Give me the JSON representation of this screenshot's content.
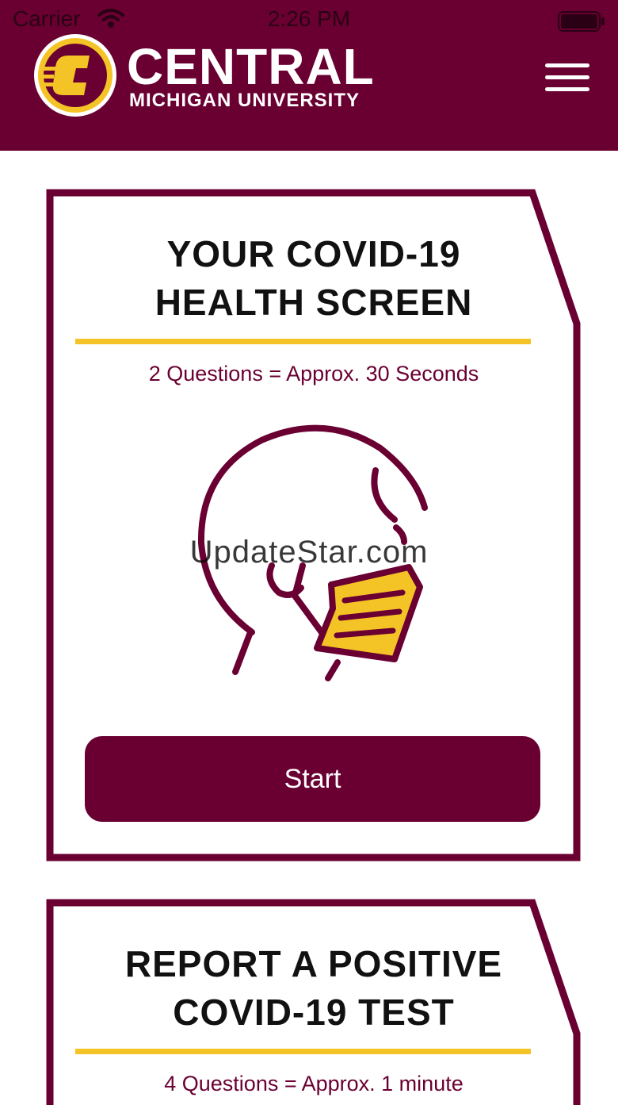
{
  "status_bar": {
    "carrier": "Carrier",
    "time": "2:26 PM",
    "wifi_icon": "wifi-icon",
    "battery_icon": "battery-icon"
  },
  "header": {
    "brand_main": "CENTRAL",
    "brand_sub": "MICHIGAN UNIVERSITY",
    "logo_icon": "cmu-c-logo-icon",
    "menu_icon": "hamburger-menu-icon"
  },
  "cards": [
    {
      "title_line1": "YOUR COVID-19",
      "title_line2": "HEALTH SCREEN",
      "meta": "2 Questions = Approx. 30 Seconds",
      "illustration_icon": "masked-face-icon",
      "button_label": "Start"
    },
    {
      "title_line1": "REPORT A POSITIVE",
      "title_line2": "COVID-19 TEST",
      "meta": "4 Questions = Approx. 1 minute"
    }
  ],
  "watermark": "UpdateStar.com",
  "colors": {
    "maroon": "#6a0032",
    "gold": "#f4c326",
    "white": "#ffffff"
  }
}
